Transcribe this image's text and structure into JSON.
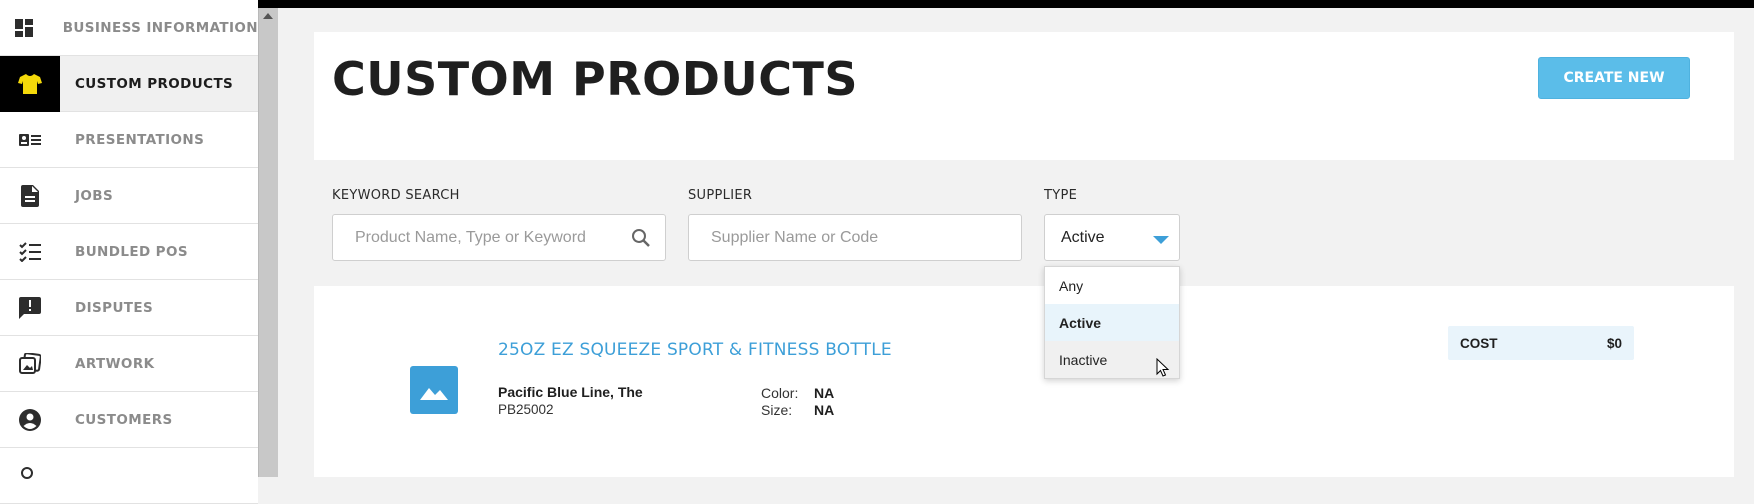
{
  "sidebar": {
    "items": [
      {
        "label": "BUSINESS INFORMATION",
        "icon": "dashboard-icon"
      },
      {
        "label": "CUSTOM PRODUCTS",
        "icon": "tshirt-icon"
      },
      {
        "label": "PRESENTATIONS",
        "icon": "presentation-icon"
      },
      {
        "label": "JOBS",
        "icon": "document-icon"
      },
      {
        "label": "BUNDLED POS",
        "icon": "checklist-icon"
      },
      {
        "label": "DISPUTES",
        "icon": "alert-message-icon"
      },
      {
        "label": "ARTWORK",
        "icon": "artwork-icon"
      },
      {
        "label": "CUSTOMERS",
        "icon": "person-icon"
      }
    ],
    "active_index": 1
  },
  "header": {
    "title": "CUSTOM PRODUCTS",
    "create_label": "CREATE NEW"
  },
  "filters": {
    "keyword_label": "KEYWORD SEARCH",
    "keyword_placeholder": "Product Name, Type or Keyword",
    "keyword_value": "",
    "supplier_label": "SUPPLIER",
    "supplier_placeholder": "Supplier Name or Code",
    "supplier_value": "",
    "type_label": "TYPE",
    "type_value": "Active",
    "type_options": [
      "Any",
      "Active",
      "Inactive"
    ]
  },
  "product": {
    "title": "25OZ EZ SQUEEZE SPORT & FITNESS BOTTLE",
    "supplier_name": "Pacific Blue Line, The",
    "supplier_code": "PB25002",
    "color_label": "Color:",
    "color_value": "NA",
    "size_label": "Size:",
    "size_value": "NA",
    "cost_label": "COST",
    "cost_value": "$0"
  },
  "colors": {
    "accent": "#3d9fd8",
    "button": "#5bbde9",
    "active_icon": "#f5d90a"
  }
}
